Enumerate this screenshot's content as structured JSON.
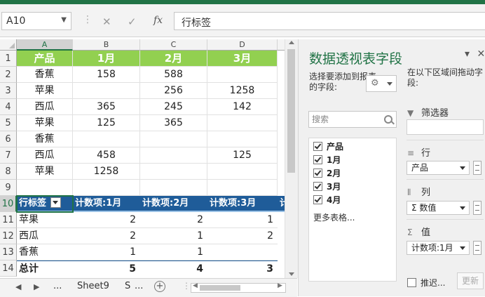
{
  "formula_bar": {
    "name_box": "A10",
    "cancel_icon": "✕",
    "enter_icon": "✓",
    "fx_label": "fx",
    "formula": "行标签"
  },
  "columns": [
    "A",
    "B",
    "C",
    "D"
  ],
  "rows": [
    {
      "n": "1",
      "a": "产品",
      "b": "1月",
      "c": "2月",
      "d": "3月"
    },
    {
      "n": "2",
      "a": "香蕉",
      "b": "158",
      "c": "588",
      "d": ""
    },
    {
      "n": "3",
      "a": "苹果",
      "b": "",
      "c": "256",
      "d": "1258"
    },
    {
      "n": "4",
      "a": "西瓜",
      "b": "365",
      "c": "245",
      "d": "142"
    },
    {
      "n": "5",
      "a": "苹果",
      "b": "125",
      "c": "365",
      "d": ""
    },
    {
      "n": "6",
      "a": "香蕉",
      "b": "",
      "c": "",
      "d": ""
    },
    {
      "n": "7",
      "a": "西瓜",
      "b": "458",
      "c": "",
      "d": "125"
    },
    {
      "n": "8",
      "a": "苹果",
      "b": "1258",
      "c": "",
      "d": ""
    },
    {
      "n": "9",
      "a": "",
      "b": "",
      "c": "",
      "d": ""
    },
    {
      "n": "10",
      "a": "行标签",
      "b": "计数项:1月",
      "c": "计数项:2月",
      "d": "计数项:3月",
      "e": "计"
    },
    {
      "n": "11",
      "a": "苹果",
      "b": "2",
      "c": "2",
      "d": "1"
    },
    {
      "n": "12",
      "a": "西瓜",
      "b": "2",
      "c": "1",
      "d": "2"
    },
    {
      "n": "13",
      "a": "香蕉",
      "b": "1",
      "c": "1",
      "d": ""
    },
    {
      "n": "14",
      "a": "总计",
      "b": "5",
      "c": "4",
      "d": "3"
    }
  ],
  "sheet_tabs": {
    "ellipsis": "...",
    "active": "Sheet9",
    "next": "S",
    "more": "..."
  },
  "pivot_pane": {
    "title": "数据透视表字段",
    "choose_hint": "选择要添加到报表的字段:",
    "drag_hint": "在以下区域间拖动字段:",
    "search_placeholder": "搜索",
    "fields": [
      "产品",
      "1月",
      "2月",
      "3月",
      "4月"
    ],
    "more_tables": "更多表格...",
    "areas": {
      "filter": "筛选器",
      "rows": "行",
      "rows_field": "产品",
      "columns": "列",
      "columns_field": "Σ 数值",
      "values": "值",
      "values_field": "计数项:1月"
    },
    "defer": "推迟...",
    "update": "更新"
  },
  "colors": {
    "excel_green": "#217346",
    "header_fill": "#92d050",
    "pivot_header": "#1f5c99"
  }
}
